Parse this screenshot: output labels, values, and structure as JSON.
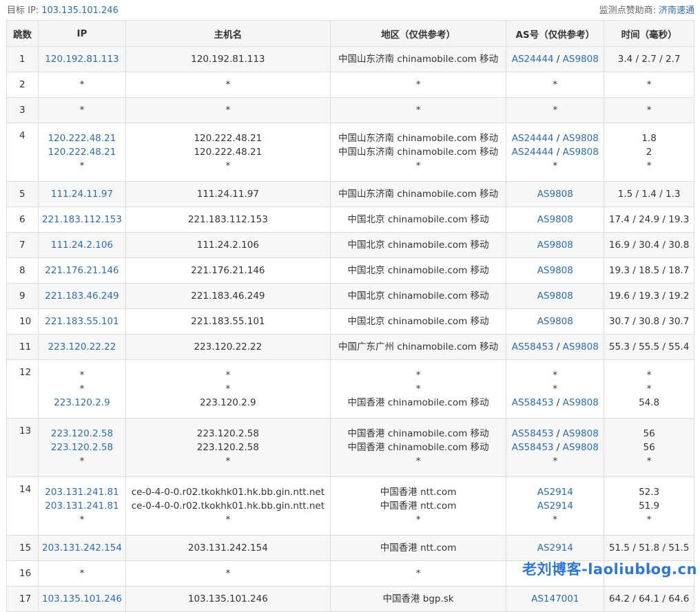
{
  "header": {
    "target_label": "目标 IP:",
    "target_ip": "103.135.101.246",
    "sponsor_label": "监测点赞助商:",
    "sponsor_name": "济南速通"
  },
  "columns": [
    "跳数",
    "IP",
    "主机名",
    "地区（仅供参考）",
    "AS号（仅供参考）",
    "时间（毫秒）"
  ],
  "hops": [
    {
      "hop": "1",
      "entries": [
        {
          "ip": "120.192.81.113",
          "host": "120.192.81.113",
          "region": "中国山东济南 chinamobile.com 移动",
          "as": [
            "AS24444",
            "AS9808"
          ],
          "time": "3.4 / 2.7 / 2.7"
        }
      ]
    },
    {
      "hop": "2",
      "entries": [
        {
          "ip": "*",
          "host": "*",
          "region": "*",
          "as": [
            "*"
          ],
          "time": "*"
        }
      ]
    },
    {
      "hop": "3",
      "entries": [
        {
          "ip": "*",
          "host": "*",
          "region": "*",
          "as": [
            "*"
          ],
          "time": "*"
        }
      ]
    },
    {
      "hop": "4",
      "entries": [
        {
          "ip": "120.222.48.21",
          "host": "120.222.48.21",
          "region": "中国山东济南 chinamobile.com 移动",
          "as": [
            "AS24444",
            "AS9808"
          ],
          "time": "1.8"
        },
        {
          "ip": "120.222.48.21",
          "host": "120.222.48.21",
          "region": "中国山东济南 chinamobile.com 移动",
          "as": [
            "AS24444",
            "AS9808"
          ],
          "time": "2"
        },
        {
          "ip": "*",
          "host": "*",
          "region": "*",
          "as": [
            "*"
          ],
          "time": "*"
        }
      ]
    },
    {
      "hop": "5",
      "entries": [
        {
          "ip": "111.24.11.97",
          "host": "111.24.11.97",
          "region": "中国山东济南 chinamobile.com 移动",
          "as": [
            "AS9808"
          ],
          "time": "1.5 / 1.4 / 1.3"
        }
      ]
    },
    {
      "hop": "6",
      "entries": [
        {
          "ip": "221.183.112.153",
          "host": "221.183.112.153",
          "region": "中国北京 chinamobile.com 移动",
          "as": [
            "AS9808"
          ],
          "time": "17.4 / 24.9 / 19.3"
        }
      ]
    },
    {
      "hop": "7",
      "entries": [
        {
          "ip": "111.24.2.106",
          "host": "111.24.2.106",
          "region": "中国北京 chinamobile.com 移动",
          "as": [
            "AS9808"
          ],
          "time": "16.9 / 30.4 / 30.8"
        }
      ]
    },
    {
      "hop": "8",
      "entries": [
        {
          "ip": "221.176.21.146",
          "host": "221.176.21.146",
          "region": "中国北京 chinamobile.com 移动",
          "as": [
            "AS9808"
          ],
          "time": "19.3 / 18.5 / 18.7"
        }
      ]
    },
    {
      "hop": "9",
      "entries": [
        {
          "ip": "221.183.46.249",
          "host": "221.183.46.249",
          "region": "中国北京 chinamobile.com 移动",
          "as": [
            "AS9808"
          ],
          "time": "19.6 / 19.3 / 19.2"
        }
      ]
    },
    {
      "hop": "10",
      "entries": [
        {
          "ip": "221.183.55.101",
          "host": "221.183.55.101",
          "region": "中国北京 chinamobile.com 移动",
          "as": [
            "AS9808"
          ],
          "time": "30.7 / 30.8 / 30.7"
        }
      ]
    },
    {
      "hop": "11",
      "entries": [
        {
          "ip": "223.120.22.22",
          "host": "223.120.22.22",
          "region": "中国广东广州 chinamobile.com 移动",
          "as": [
            "AS58453",
            "AS9808"
          ],
          "time": "55.3 / 55.5 / 55.4"
        }
      ]
    },
    {
      "hop": "12",
      "entries": [
        {
          "ip": "*",
          "host": "*",
          "region": "*",
          "as": [
            "*"
          ],
          "time": "*"
        },
        {
          "ip": "*",
          "host": "*",
          "region": "*",
          "as": [
            "*"
          ],
          "time": "*"
        },
        {
          "ip": "223.120.2.9",
          "host": "223.120.2.9",
          "region": "中国香港 chinamobile.com 移动",
          "as": [
            "AS58453",
            "AS9808"
          ],
          "time": "54.8"
        }
      ]
    },
    {
      "hop": "13",
      "entries": [
        {
          "ip": "223.120.2.58",
          "host": "223.120.2.58",
          "region": "中国香港 chinamobile.com 移动",
          "as": [
            "AS58453",
            "AS9808"
          ],
          "time": "56"
        },
        {
          "ip": "223.120.2.58",
          "host": "223.120.2.58",
          "region": "中国香港 chinamobile.com 移动",
          "as": [
            "AS58453",
            "AS9808"
          ],
          "time": "56"
        },
        {
          "ip": "*",
          "host": "*",
          "region": "*",
          "as": [
            "*"
          ],
          "time": "*"
        }
      ]
    },
    {
      "hop": "14",
      "entries": [
        {
          "ip": "203.131.241.81",
          "host": "ce-0-4-0-0.r02.tkokhk01.hk.bb.gin.ntt.net",
          "region": "中国香港 ntt.com",
          "as": [
            "AS2914"
          ],
          "time": "52.3"
        },
        {
          "ip": "203.131.241.81",
          "host": "ce-0-4-0-0.r02.tkokhk01.hk.bb.gin.ntt.net",
          "region": "中国香港 ntt.com",
          "as": [
            "AS2914"
          ],
          "time": "51.9"
        },
        {
          "ip": "*",
          "host": "*",
          "region": "*",
          "as": [
            "*"
          ],
          "time": "*"
        }
      ]
    },
    {
      "hop": "15",
      "entries": [
        {
          "ip": "203.131.242.154",
          "host": "203.131.242.154",
          "region": "中国香港 ntt.com",
          "as": [
            "AS2914"
          ],
          "time": "51.5 / 51.8 / 51.5"
        }
      ]
    },
    {
      "hop": "16",
      "entries": [
        {
          "ip": "*",
          "host": "*",
          "region": "*",
          "as": [
            "*"
          ],
          "time": "*"
        }
      ]
    },
    {
      "hop": "17",
      "entries": [
        {
          "ip": "103.135.101.246",
          "host": "103.135.101.246",
          "region": "中国香港 bgp.sk",
          "as": [
            "AS147001"
          ],
          "time": "64.2 / 64.1 / 64.6"
        }
      ]
    }
  ],
  "watermark": "老刘博客-laoliublog.cn",
  "colors": {
    "link": "#2b6cb0",
    "header_bg": "#f5f5f5",
    "stripe_bg": "#f7f7f7",
    "border": "#dcdcdc",
    "watermark": "#2f78d4"
  }
}
